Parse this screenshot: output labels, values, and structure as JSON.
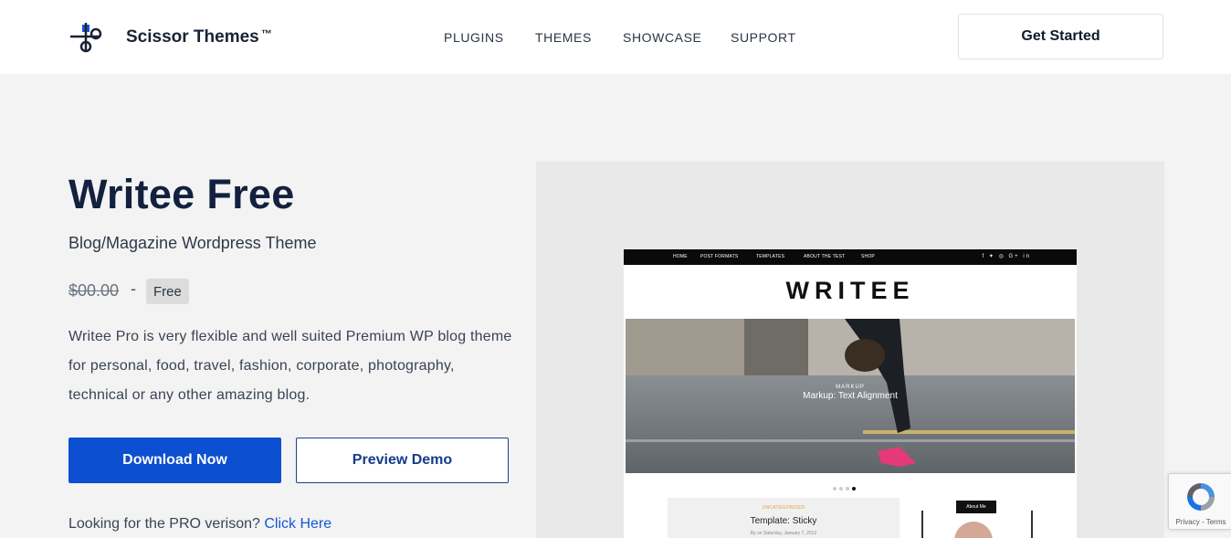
{
  "header": {
    "brand": "Scissor Themes",
    "trademark": "™",
    "nav": [
      "PLUGINS",
      "THEMES",
      "SHOWCASE",
      "SUPPORT"
    ],
    "cta_label": "Get Started",
    "logo_icon": "scissor-logo-icon"
  },
  "product": {
    "title": "Writee Free",
    "subtitle": "Blog/Magazine Wordpress Theme",
    "old_price": "$00.00",
    "price_separator": "-",
    "price_badge": "Free",
    "description": "Writee Pro is very flexible and well suited Premium WP blog theme for personal, food, travel, fashion, corporate, photography, technical or any other amazing blog.",
    "download_label": "Download Now",
    "preview_label": "Preview Demo",
    "pro_prompt": "Looking for the PRO verison?",
    "pro_link": "Click Here"
  },
  "preview": {
    "nav": [
      "HOME",
      "POST FORMATS",
      "TEMPLATES",
      "ABOUT THE TEST",
      "SHOP"
    ],
    "social": "f ✦ ◎ G+ in",
    "logo": "WRITEE",
    "hero_label": "MARKUP",
    "hero_title": "Markup: Text Alignment",
    "post_category": "UNCATEGORIZED",
    "post_title": "Template: Sticky",
    "post_meta": "By on Saturday, January 7, 2012",
    "sidebar_title": "About Me"
  },
  "recaptcha": {
    "text": "Privacy - Terms"
  },
  "colors": {
    "primary": "#0c4fd0",
    "title": "#13213f",
    "background": "#f3f3f3"
  }
}
